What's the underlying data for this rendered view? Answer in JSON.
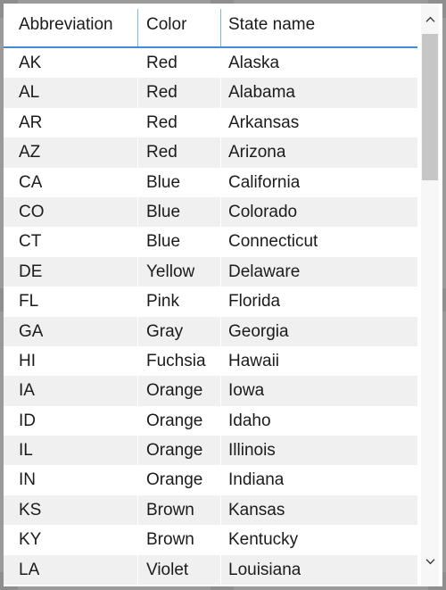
{
  "table": {
    "columns": [
      "Abbreviation",
      "Color",
      "State name"
    ],
    "rows": [
      {
        "abbreviation": "AK",
        "color": "Red",
        "state": "Alaska"
      },
      {
        "abbreviation": "AL",
        "color": "Red",
        "state": "Alabama"
      },
      {
        "abbreviation": "AR",
        "color": "Red",
        "state": "Arkansas"
      },
      {
        "abbreviation": "AZ",
        "color": "Red",
        "state": "Arizona"
      },
      {
        "abbreviation": "CA",
        "color": "Blue",
        "state": "California"
      },
      {
        "abbreviation": "CO",
        "color": "Blue",
        "state": "Colorado"
      },
      {
        "abbreviation": "CT",
        "color": "Blue",
        "state": "Connecticut"
      },
      {
        "abbreviation": "DE",
        "color": "Yellow",
        "state": "Delaware"
      },
      {
        "abbreviation": "FL",
        "color": "Pink",
        "state": "Florida"
      },
      {
        "abbreviation": "GA",
        "color": "Gray",
        "state": "Georgia"
      },
      {
        "abbreviation": "HI",
        "color": "Fuchsia",
        "state": "Hawaii"
      },
      {
        "abbreviation": "IA",
        "color": "Orange",
        "state": "Iowa"
      },
      {
        "abbreviation": "ID",
        "color": "Orange",
        "state": "Idaho"
      },
      {
        "abbreviation": "IL",
        "color": "Orange",
        "state": "Illinois"
      },
      {
        "abbreviation": "IN",
        "color": "Orange",
        "state": "Indiana"
      },
      {
        "abbreviation": "KS",
        "color": "Brown",
        "state": "Kansas"
      },
      {
        "abbreviation": "KY",
        "color": "Brown",
        "state": "Kentucky"
      },
      {
        "abbreviation": "LA",
        "color": "Violet",
        "state": "Louisiana"
      }
    ]
  },
  "scrollbar": {
    "up_icon": "chevron-up-icon",
    "down_icon": "chevron-down-icon",
    "orientation": "vertical"
  },
  "colors": {
    "header_underline": "#3b8cdb",
    "header_divider": "#7cb5e8",
    "row_alt_background": "#f0f0f0",
    "row_background": "#ffffff",
    "text": "#1b1b1b",
    "frame_border": "#9a9a9a",
    "scrollbar_track": "#f7f7f7",
    "scrollbar_thumb": "#c6c6c6"
  }
}
